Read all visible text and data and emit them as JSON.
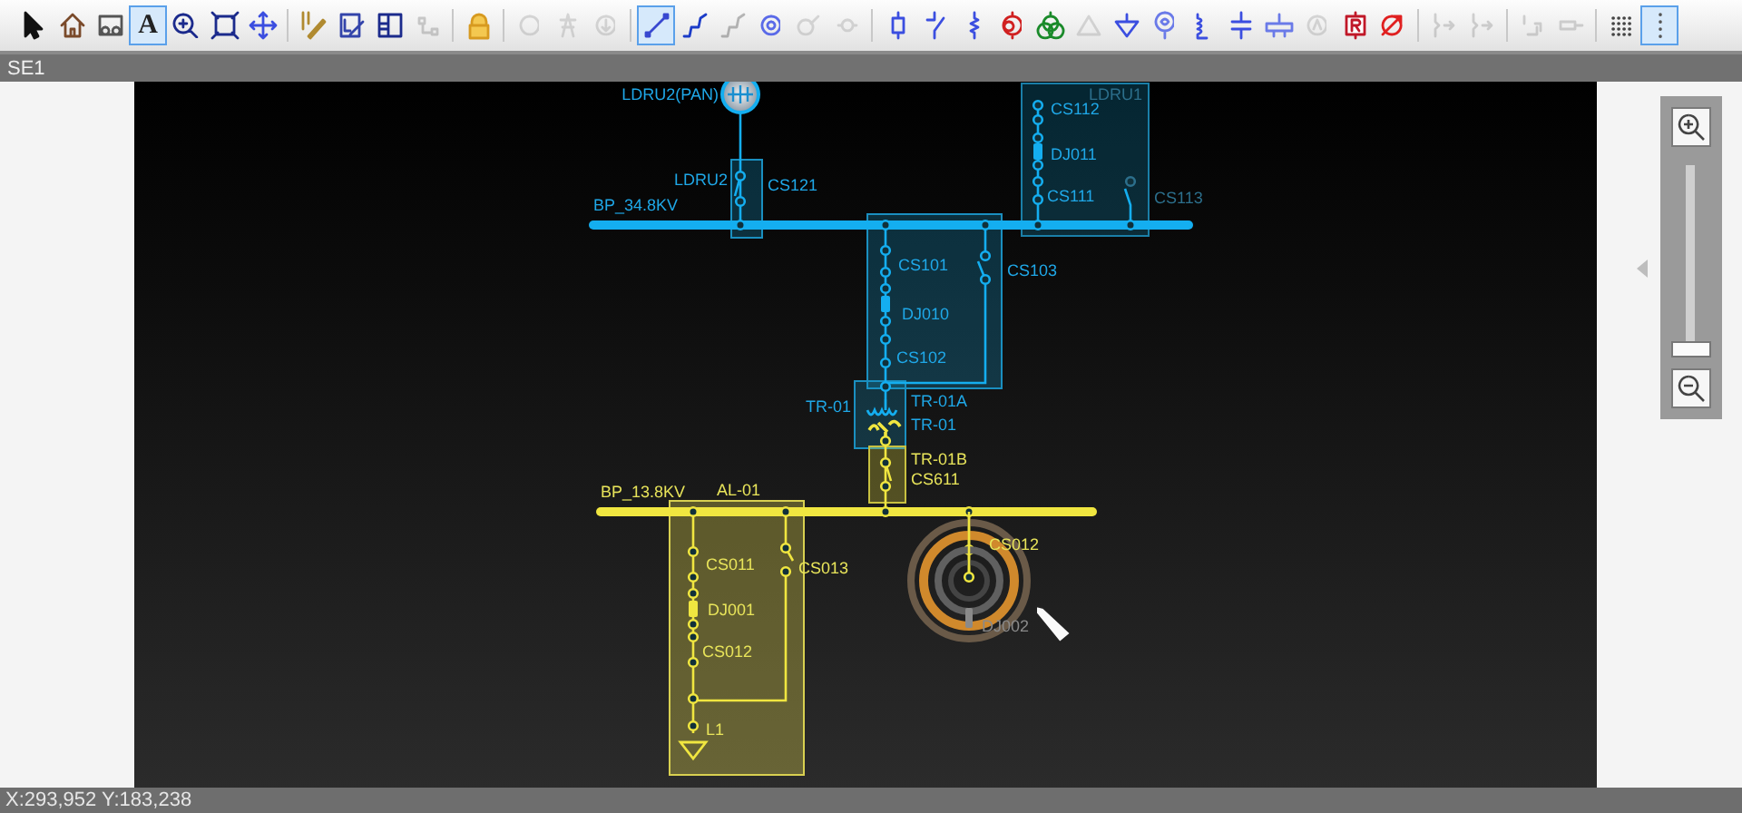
{
  "toolbar": {
    "groups": [
      [
        {
          "kind": "pointer",
          "selected": false,
          "disabled": false
        },
        {
          "kind": "home",
          "selected": false,
          "disabled": false
        },
        {
          "kind": "select",
          "selected": false,
          "disabled": false
        },
        {
          "kind": "text",
          "glyph": "A",
          "selected": true,
          "disabled": false
        },
        {
          "kind": "zoom",
          "selected": false,
          "disabled": false
        },
        {
          "kind": "fit",
          "selected": false,
          "disabled": false
        },
        {
          "kind": "pan",
          "selected": false,
          "disabled": false
        }
      ],
      [
        {
          "kind": "pencil",
          "selected": false,
          "disabled": false
        },
        {
          "kind": "edit",
          "selected": false,
          "disabled": false
        },
        {
          "kind": "panel",
          "selected": false,
          "disabled": false
        },
        {
          "kind": "graph",
          "selected": false,
          "disabled": true
        }
      ],
      [
        {
          "kind": "lock",
          "selected": false,
          "disabled": false
        }
      ],
      [
        {
          "kind": "circle",
          "selected": false,
          "disabled": true
        },
        {
          "kind": "tower",
          "selected": false,
          "disabled": true
        },
        {
          "kind": "download",
          "selected": false,
          "disabled": true
        }
      ],
      [
        {
          "kind": "line",
          "selected": true,
          "disabled": false
        },
        {
          "kind": "polyline",
          "selected": false,
          "disabled": false
        },
        {
          "kind": "polyline",
          "selected": false,
          "disabled": true
        },
        {
          "kind": "target",
          "selected": false,
          "disabled": false
        },
        {
          "kind": "probe",
          "selected": false,
          "disabled": true
        },
        {
          "kind": "node",
          "selected": false,
          "disabled": true
        }
      ],
      [
        {
          "kind": "breaker",
          "selected": false,
          "disabled": false
        },
        {
          "kind": "switch",
          "selected": false,
          "disabled": false
        },
        {
          "kind": "resistor",
          "selected": false,
          "disabled": false
        },
        {
          "kind": "transformer",
          "selected": false,
          "disabled": false
        },
        {
          "kind": "transformer3",
          "selected": false,
          "disabled": false
        },
        {
          "kind": "triangle",
          "selected": false,
          "disabled": true
        },
        {
          "kind": "ground",
          "selected": false,
          "disabled": false
        },
        {
          "kind": "generator",
          "selected": false,
          "disabled": false
        },
        {
          "kind": "inductor",
          "selected": false,
          "disabled": false
        },
        {
          "kind": "capacitor",
          "selected": false,
          "disabled": false
        },
        {
          "kind": "bus",
          "selected": false,
          "disabled": false
        },
        {
          "kind": "meter",
          "selected": false,
          "disabled": true
        },
        {
          "kind": "relay",
          "selected": false,
          "disabled": false
        },
        {
          "kind": "arrow",
          "selected": false,
          "disabled": false
        }
      ],
      [
        {
          "kind": "jump",
          "selected": false,
          "disabled": true
        },
        {
          "kind": "jump",
          "selected": false,
          "disabled": true
        }
      ],
      [
        {
          "kind": "connector",
          "selected": false,
          "disabled": true
        },
        {
          "kind": "plug",
          "selected": false,
          "disabled": true
        }
      ],
      [
        {
          "kind": "grid",
          "selected": false,
          "disabled": false
        },
        {
          "kind": "handle",
          "selected": true,
          "disabled": false
        }
      ]
    ]
  },
  "tab": {
    "title": "SE1"
  },
  "diagram": {
    "labels": [
      {
        "text": "LDRU2(PAN)",
        "color": "#1fa8e8"
      },
      {
        "text": "LDRU1",
        "color": "#2c6f8c"
      },
      {
        "text": "CS112",
        "color": "#1fa8e8"
      },
      {
        "text": "DJ011",
        "color": "#1fa8e8"
      },
      {
        "text": "LDRU2",
        "color": "#1fa8e8"
      },
      {
        "text": "CS121",
        "color": "#1fa8e8"
      },
      {
        "text": "CS111",
        "color": "#1fa8e8"
      },
      {
        "text": "CS113",
        "color": "#2c6f8c"
      },
      {
        "text": "BP_34.8KV",
        "color": "#1fa8e8"
      },
      {
        "text": "CS101",
        "color": "#1fa8e8"
      },
      {
        "text": "CS103",
        "color": "#1fa8e8"
      },
      {
        "text": "DJ010",
        "color": "#1fa8e8"
      },
      {
        "text": "CS102",
        "color": "#1fa8e8"
      },
      {
        "text": "TR-01A",
        "color": "#1fa8e8"
      },
      {
        "text": "TR-01",
        "color": "#1fa8e8"
      },
      {
        "text": "TR-01",
        "color": "#1fa8e8"
      },
      {
        "text": "TR-01B",
        "color": "#e8e45a"
      },
      {
        "text": "CS611",
        "color": "#e8e45a"
      },
      {
        "text": "BP_13.8KV",
        "color": "#e8e45a"
      },
      {
        "text": "AL-01",
        "color": "#e8e45a"
      },
      {
        "text": "CS012",
        "color": "#e8e45a"
      },
      {
        "text": "CS011",
        "color": "#e8e45a"
      },
      {
        "text": "CS013",
        "color": "#e8e45a"
      },
      {
        "text": "DJ001",
        "color": "#e8e45a"
      },
      {
        "text": "DJ002",
        "color": "#8a8a8a"
      },
      {
        "text": "CS012",
        "color": "#e8e45a"
      },
      {
        "text": "L1",
        "color": "#e8e45a"
      }
    ]
  },
  "zoom_slider": {
    "level": 0
  },
  "status_bar": {
    "text": "X:293,952 Y:183,238"
  }
}
